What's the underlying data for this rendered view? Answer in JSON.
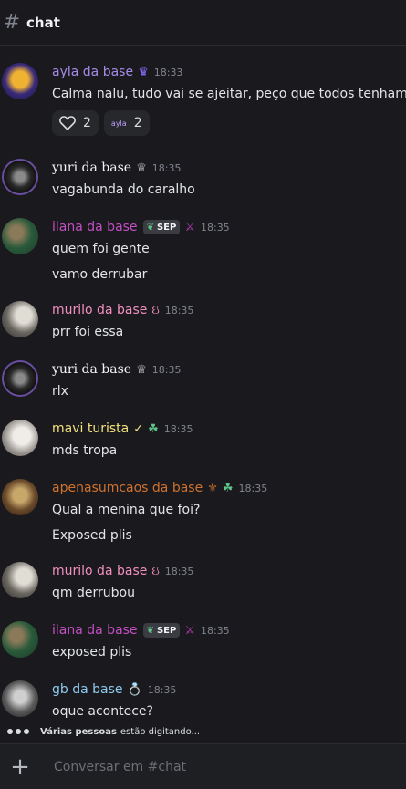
{
  "header": {
    "hash_icon": "#",
    "title": "chat"
  },
  "messages": [
    {
      "username": "ayla da base",
      "color": "#a48be8",
      "time": "18:33",
      "text": "Calma nalu, tudo vai se ajeitar,  peço que todos tenham calma",
      "reactions": [
        {
          "icon": "heart-outline-icon",
          "count": "2"
        },
        {
          "icon_text": "ayla",
          "count": "2"
        }
      ]
    },
    {
      "username": "yuri da base",
      "color": "#f2f3f5",
      "time": "18:35",
      "text": "vagabunda do caralho"
    },
    {
      "username": "ilana da base",
      "color": "#c44ec4",
      "time": "18:35",
      "tag": "SEP",
      "text": "quem foi gente",
      "text2": "vamo derrubar"
    },
    {
      "username": "murilo da base",
      "color": "#f28fbe",
      "time": "18:35",
      "text": "prr foi essa"
    },
    {
      "username": "yuri da base",
      "color": "#f2f3f5",
      "time": "18:35",
      "text": "rlx"
    },
    {
      "username": "mavi turista",
      "color": "#f3e37c",
      "time": "18:35",
      "text": "mds tropa"
    },
    {
      "username": "apenasumcaos da base",
      "color": "#d0722d",
      "time": "18:35",
      "text": "Qual a menina que foi?",
      "text2": "Exposed plis"
    },
    {
      "username": "murilo da base",
      "color": "#f28fbe",
      "time": "18:35",
      "text": "qm derrubou"
    },
    {
      "username": "ilana da base",
      "color": "#c44ec4",
      "time": "18:35",
      "tag": "SEP",
      "text": "exposed plis"
    },
    {
      "username": "gb da base",
      "color": "#8ecbf0",
      "time": "18:35",
      "text": "oque acontece?"
    }
  ],
  "typing": {
    "who": "Várias pessoas",
    "rest": "estão digitando..."
  },
  "composer": {
    "placeholder": "Conversar em #chat",
    "plus_icon": "+"
  }
}
